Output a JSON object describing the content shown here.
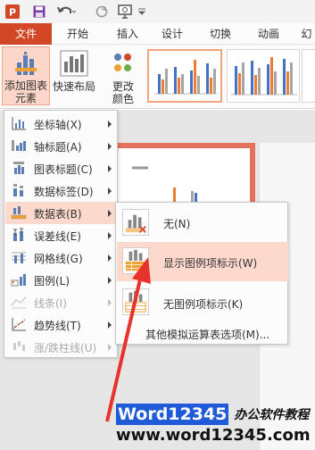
{
  "ribbon_tabs": [
    "文件",
    "开始",
    "插入",
    "设计",
    "切换",
    "动画",
    "幻"
  ],
  "ribbon": {
    "add_chart_element": [
      "添加图表",
      "元素"
    ],
    "quick_layout": "快速布局",
    "change_colors": [
      "更改",
      "颜色"
    ]
  },
  "menu_items": [
    {
      "label": "坐标轴(X)",
      "disabled": false
    },
    {
      "label": "轴标题(A)",
      "disabled": false
    },
    {
      "label": "图表标题(C)",
      "disabled": false
    },
    {
      "label": "数据标签(D)",
      "disabled": false
    },
    {
      "label": "数据表(B)",
      "disabled": false,
      "highlighted": true
    },
    {
      "label": "误差线(E)",
      "disabled": false
    },
    {
      "label": "网格线(G)",
      "disabled": false
    },
    {
      "label": "图例(L)",
      "disabled": false
    },
    {
      "label": "线条(I)",
      "disabled": true
    },
    {
      "label": "趋势线(T)",
      "disabled": false
    },
    {
      "label": "涨/跌柱线(U)",
      "disabled": true
    }
  ],
  "submenu": {
    "items": [
      {
        "label": "无(N)"
      },
      {
        "label": "显示图例项标示(W)",
        "highlighted": true
      },
      {
        "label": "无图例项标示(K)"
      }
    ],
    "more": "其他模拟运算表选项(M)..."
  },
  "watermark": {
    "logo_word": "Word12345",
    "logo_cn": "办公软件教程",
    "url": "www.word12345.com"
  },
  "colors": {
    "accent": "#d24726",
    "highlight": "#fcd9cc",
    "arrow": "#e8322b"
  }
}
